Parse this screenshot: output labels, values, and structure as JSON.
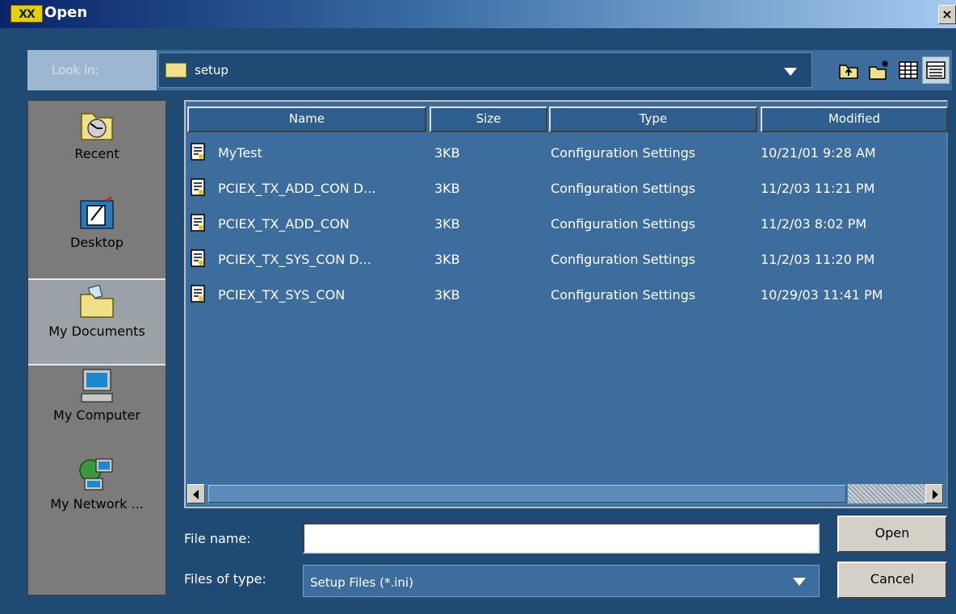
{
  "window": {
    "title": "Open",
    "logo_text": "XX"
  },
  "toolbar": {
    "lookin_label": "Look in:",
    "lookin_value": "setup"
  },
  "places": [
    {
      "label": "Recent",
      "icon": "recent-icon"
    },
    {
      "label": "Desktop",
      "icon": "desktop-icon"
    },
    {
      "label": "My Documents",
      "icon": "documents-icon",
      "selected": true
    },
    {
      "label": "My Computer",
      "icon": "computer-icon"
    },
    {
      "label": "My Network ...",
      "icon": "network-icon"
    }
  ],
  "columns": [
    "Name",
    "Size",
    "Type",
    "Modified"
  ],
  "files": [
    {
      "name": "MyTest",
      "size": "3KB",
      "type": "Configuration Settings",
      "modified": "10/21/01 9:28 AM"
    },
    {
      "name": "PCIEX_TX_ADD_CON D...",
      "size": "3KB",
      "type": "Configuration Settings",
      "modified": "11/2/03 11:21 PM"
    },
    {
      "name": "PCIEX_TX_ADD_CON",
      "size": "3KB",
      "type": "Configuration Settings",
      "modified": "11/2/03 8:02 PM"
    },
    {
      "name": "PCIEX_TX_SYS_CON D...",
      "size": "3KB",
      "type": "Configuration Settings",
      "modified": "11/2/03 11:20 PM"
    },
    {
      "name": "PCIEX_TX_SYS_CON",
      "size": "3KB",
      "type": "Configuration Settings",
      "modified": "10/29/03 11:41 PM"
    }
  ],
  "form": {
    "file_name_label": "File name:",
    "file_name_value": "",
    "file_type_label": "Files of type:",
    "file_type_value": "Setup Files (*.ini)"
  },
  "buttons": {
    "open": "Open",
    "cancel": "Cancel",
    "close": "×"
  }
}
